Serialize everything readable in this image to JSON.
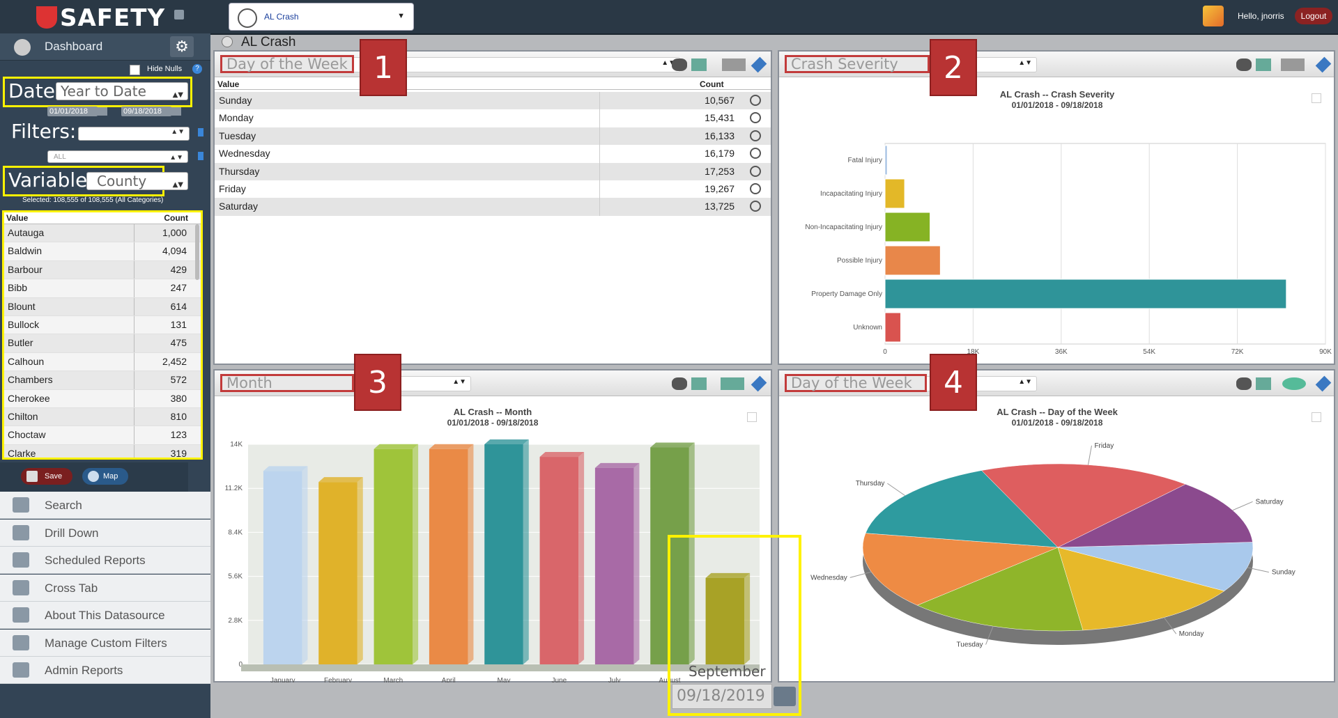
{
  "header": {
    "logo": "SAFETY",
    "datasource": "AL Crash",
    "greeting": "Hello, jnorris",
    "logout": "Logout"
  },
  "sidebar": {
    "dashboard": "Dashboard",
    "hide_nulls": "Hide Nulls",
    "date_label": "Date:",
    "date_value": "Year to Date",
    "date_from": "01/01/2018",
    "date_to": "09/18/2018",
    "filters_label": "Filters:",
    "filter_all": "ALL",
    "variable_label": "Variable:",
    "variable_value": "County",
    "selected_text": "Selected: 108,555 of 108,555 (All Categories)",
    "table_headers": {
      "value": "Value",
      "count": "Count"
    },
    "counties": [
      {
        "name": "Autauga",
        "count": "1,000"
      },
      {
        "name": "Baldwin",
        "count": "4,094"
      },
      {
        "name": "Barbour",
        "count": "429"
      },
      {
        "name": "Bibb",
        "count": "247"
      },
      {
        "name": "Blount",
        "count": "614"
      },
      {
        "name": "Bullock",
        "count": "131"
      },
      {
        "name": "Butler",
        "count": "475"
      },
      {
        "name": "Calhoun",
        "count": "2,452"
      },
      {
        "name": "Chambers",
        "count": "572"
      },
      {
        "name": "Cherokee",
        "count": "380"
      },
      {
        "name": "Chilton",
        "count": "810"
      },
      {
        "name": "Choctaw",
        "count": "123"
      },
      {
        "name": "Clarke",
        "count": "319"
      }
    ],
    "save": "Save",
    "map": "Map",
    "menu": [
      "Search",
      "Drill Down",
      "Scheduled Reports",
      "Cross Tab",
      "About This Datasource",
      "Manage Custom Filters",
      "Admin Reports"
    ]
  },
  "main": {
    "breadcrumb": "AL Crash",
    "panel1": {
      "title": "Day of the Week",
      "number": "1",
      "headers": {
        "value": "Value",
        "count": "Count"
      },
      "rows": [
        {
          "day": "Sunday",
          "count": "10,567"
        },
        {
          "day": "Monday",
          "count": "15,431"
        },
        {
          "day": "Tuesday",
          "count": "16,133"
        },
        {
          "day": "Wednesday",
          "count": "16,179"
        },
        {
          "day": "Thursday",
          "count": "17,253"
        },
        {
          "day": "Friday",
          "count": "19,267"
        },
        {
          "day": "Saturday",
          "count": "13,725"
        }
      ]
    },
    "panel2": {
      "title": "Crash Severity",
      "number": "2",
      "chart_title": "AL Crash -- Crash Severity",
      "chart_sub": "01/01/2018 - 09/18/2018"
    },
    "panel3": {
      "title": "Month",
      "number": "3",
      "chart_title": "AL Crash -- Month",
      "chart_sub": "01/01/2018 - 09/18/2018",
      "callout_month": "September",
      "callout_date": "09/18/2019"
    },
    "panel4": {
      "title": "Day of the Week",
      "number": "4",
      "chart_title": "AL Crash -- Day of the Week",
      "chart_sub": "01/01/2018 - 09/18/2018"
    }
  },
  "chart_data": [
    {
      "type": "bar",
      "orientation": "horizontal",
      "categories": [
        "Fatal Injury",
        "Incapacitating Injury",
        "Non-Incapacitating Injury",
        "Possible Injury",
        "Property Damage Only",
        "Unknown"
      ],
      "values": [
        400,
        4000,
        9200,
        11300,
        82000,
        3200
      ],
      "xlim": [
        0,
        90000
      ],
      "xticks": [
        "0",
        "18K",
        "36K",
        "54K",
        "72K",
        "90K"
      ],
      "colors": [
        "#9bbbe0",
        "#e3b828",
        "#86b324",
        "#e8874a",
        "#2f9499",
        "#d9534f"
      ],
      "grid": true
    },
    {
      "type": "bar",
      "categories": [
        "January",
        "February",
        "March",
        "April",
        "May",
        "June",
        "July",
        "August",
        "September"
      ],
      "values": [
        12300,
        11600,
        13700,
        13700,
        14000,
        13200,
        12500,
        13800,
        5500
      ],
      "ylim": [
        0,
        14000
      ],
      "yticks": [
        "0",
        "2.8K",
        "5.6K",
        "8.4K",
        "11.2K",
        "14K"
      ],
      "colors": [
        "#bcd4ee",
        "#e0b22a",
        "#9fc43a",
        "#ea8a46",
        "#2f9499",
        "#d9666a",
        "#a86aa6",
        "#76a04a",
        "#a8a226"
      ]
    },
    {
      "type": "pie",
      "categories": [
        "Sunday",
        "Monday",
        "Tuesday",
        "Wednesday",
        "Thursday",
        "Friday",
        "Saturday"
      ],
      "values": [
        10567,
        15431,
        16133,
        16179,
        17253,
        19267,
        13725
      ],
      "colors": [
        "#a9c9ec",
        "#e7b92a",
        "#8fb52a",
        "#ee8b44",
        "#2e9b9f",
        "#de5e5f",
        "#8b4a8e"
      ]
    }
  ]
}
